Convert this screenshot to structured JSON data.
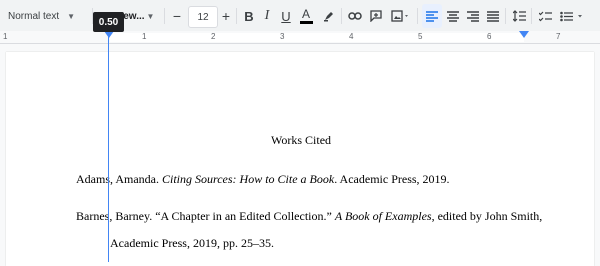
{
  "toolbar": {
    "paragraph_style": "Normal text",
    "font": "New...",
    "font_size": "12",
    "minus_label": "−",
    "plus_label": "+",
    "bold_label": "B",
    "italic_label": "I",
    "underline_label": "U",
    "text_color_label": "A",
    "icons": [
      "highlight-icon",
      "link-icon",
      "comment-icon",
      "image-icon",
      "align-left-icon",
      "align-center-icon",
      "align-right-icon",
      "justify-icon",
      "line-spacing-icon",
      "checklist-icon",
      "bullet-list-icon"
    ]
  },
  "tooltip": "0.50",
  "ruler": {
    "numbers": [
      "1",
      "1",
      "2",
      "3",
      "4",
      "5",
      "6",
      "7"
    ]
  },
  "document": {
    "title": "Works Cited",
    "entries": [
      {
        "author": "Adams, Amanda. ",
        "title_italic": "Citing Sources: How to Cite a Book",
        "rest": ". Academic Press, 2019."
      },
      {
        "line1_prefix": "Barnes, Barney. “A Chapter in an Edited Collection.” ",
        "title_italic": "A Book of Examples",
        "line1_suffix": ", edited by John Smith,",
        "line2": "Academic Press, 2019, pp. 25–35."
      }
    ]
  },
  "colors": {
    "accent": "#4285f4",
    "toolbar_bg": "#f1f3f4",
    "page_bg": "#ffffff"
  }
}
